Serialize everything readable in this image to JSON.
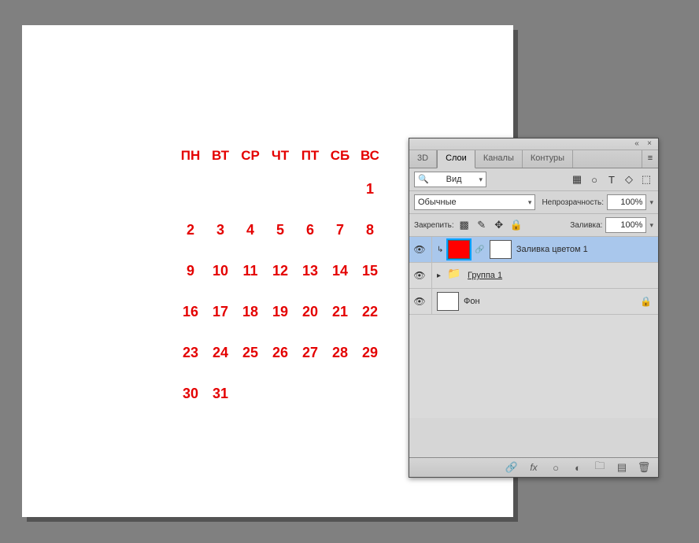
{
  "calendar": {
    "headers": [
      "ПН",
      "ВТ",
      "СР",
      "ЧТ",
      "ПТ",
      "СБ",
      "ВС"
    ],
    "rows": [
      [
        "",
        "",
        "",
        "",
        "",
        "",
        "1"
      ],
      [
        "2",
        "3",
        "4",
        "5",
        "6",
        "7",
        "8"
      ],
      [
        "9",
        "10",
        "11",
        "12",
        "13",
        "14",
        "15"
      ],
      [
        "16",
        "17",
        "18",
        "19",
        "20",
        "21",
        "22"
      ],
      [
        "23",
        "24",
        "25",
        "26",
        "27",
        "28",
        "29"
      ],
      [
        "30",
        "31",
        "",
        "",
        "",
        "",
        ""
      ]
    ]
  },
  "panel": {
    "tabs": {
      "t0": "3D",
      "t1": "Слои",
      "t2": "Каналы",
      "t3": "Контуры"
    },
    "filter_label": "Вид",
    "blend_mode": "Обычные",
    "opacity_label": "Непрозрачность:",
    "opacity_value": "100%",
    "lock_label": "Закрепить:",
    "fill_label": "Заливка:",
    "fill_value": "100%",
    "layers": {
      "l0": "Заливка цветом 1",
      "l1": "Группа 1",
      "l2": "Фон"
    }
  },
  "icons": {
    "search": "🔍",
    "chev": "▾",
    "picture": "▦",
    "type": "T",
    "shape": "◇",
    "smart": "⬚",
    "artboard": "✿",
    "pixels": "▩",
    "brush": "✎",
    "move": "✥",
    "lock": "🔒",
    "eye": "👁",
    "link": "⬌",
    "folder": "📁",
    "triangle": "▸",
    "fx": "fx",
    "circle": "○",
    "mask": "◐",
    "new_group": "🗀",
    "new_layer": "▤",
    "trash": "🗑",
    "chain": "🔗",
    "menu": "≡",
    "collapse": "«",
    "close": "×",
    "clip": "↳"
  }
}
